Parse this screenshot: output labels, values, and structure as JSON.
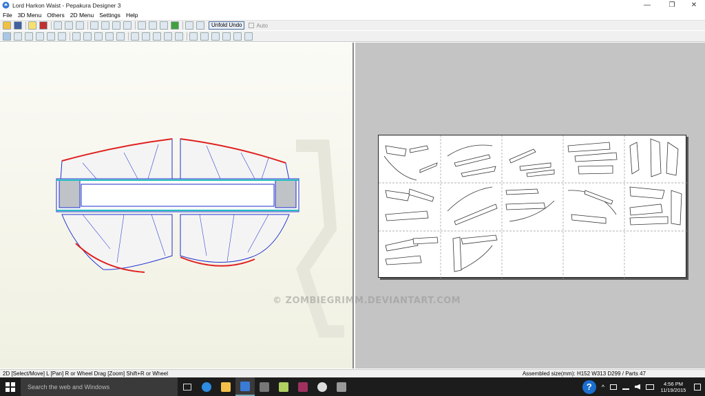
{
  "window": {
    "title": "Lord Harkon Waist - Pepakura Designer 3",
    "min": "—",
    "max": "❐",
    "close": "✕"
  },
  "menu": [
    "File",
    "3D Menu",
    "Others",
    "2D Menu",
    "Settings",
    "Help"
  ],
  "toolbar": {
    "unfold_undo": "Unfold Undo",
    "auto": "Auto"
  },
  "watermark": "© ZOMBIEGRIMM.DEVIANTART.COM",
  "status": {
    "left": "2D [Select/Move] L [Pan] R or Wheel Drag [Zoom] Shift+R or Wheel",
    "right": "Assembled size(mm): H152 W313 D299 / Parts 47"
  },
  "taskbar": {
    "search_placeholder": "Search the web and Windows",
    "time": "4:56 PM",
    "date": "11/19/2015",
    "help": "?"
  },
  "colors": {
    "accent_red": "#e02020",
    "accent_blue": "#2030d0",
    "accent_cyan": "#20c0c0"
  }
}
